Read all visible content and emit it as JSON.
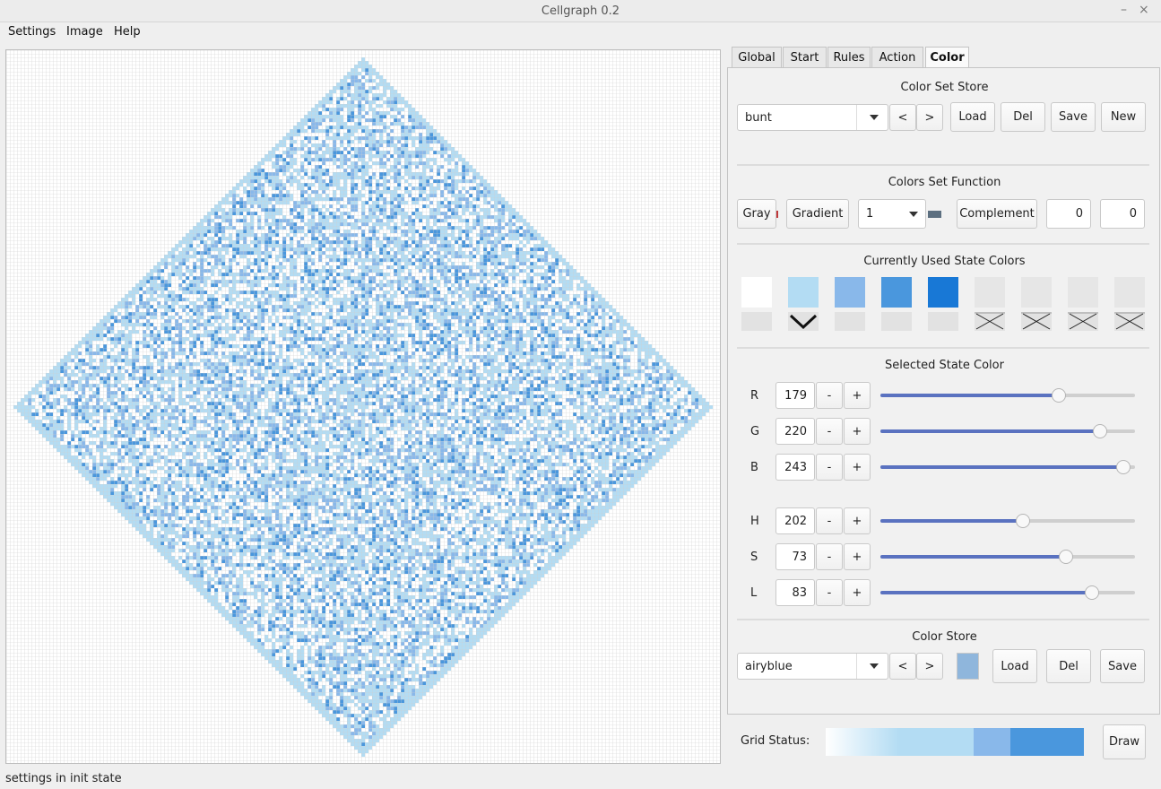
{
  "window": {
    "title": "Cellgraph 0.2",
    "minimize": "–",
    "close": "×"
  },
  "menu": [
    "Settings",
    "Image",
    "Help"
  ],
  "status_text": "settings in init state",
  "tabs": [
    "Global",
    "Start",
    "Rules",
    "Action",
    "Color"
  ],
  "active_tab": "Color",
  "color_set_store": {
    "header": "Color Set Store",
    "selected": "bunt",
    "prev": "<",
    "next": ">",
    "load": "Load",
    "del": "Del",
    "save": "Save",
    "new": "New",
    "swatches": [
      "#a08a4e",
      "#c0393b",
      "#e07b3c",
      "#7ecfcf",
      "#1a9a8e",
      "#f2c94c",
      "#8a1f2e",
      "#5f97ea",
      "#5c6f80"
    ]
  },
  "colors_set_function": {
    "header": "Colors Set Function",
    "gray": "Gray",
    "gradient": "Gradient",
    "steps": "1",
    "complement": "Complement",
    "value_a": "0",
    "value_b": "0"
  },
  "state_colors": {
    "header": "Currently Used State Colors",
    "colors": [
      "#ffffff",
      "#b3dcf3",
      "#89b8ea",
      "#4a97dd",
      "#1878d6",
      "#e6e6e6",
      "#e6e6e6",
      "#e6e6e6",
      "#e6e6e6"
    ],
    "selected_index": 1,
    "disabled_from": 5
  },
  "selected_state_color": {
    "header": "Selected State Color",
    "rgb": [
      {
        "label": "R",
        "value": "179",
        "fraction": 0.702
      },
      {
        "label": "G",
        "value": "220",
        "fraction": 0.863
      },
      {
        "label": "B",
        "value": "243",
        "fraction": 0.953
      }
    ],
    "hsl": [
      {
        "label": "H",
        "value": "202",
        "fraction": 0.561
      },
      {
        "label": "S",
        "value": "73",
        "fraction": 0.73
      },
      {
        "label": "L",
        "value": "83",
        "fraction": 0.83
      }
    ],
    "minus": "-",
    "plus": "+"
  },
  "color_store": {
    "header": "Color Store",
    "selected": "airyblue",
    "prev": "<",
    "next": ">",
    "preview_color": "#8fb6dc",
    "load": "Load",
    "del": "Del",
    "save": "Save"
  },
  "grid_status": {
    "label": "Grid Status:",
    "draw": "Draw",
    "segments": [
      "#ffffff",
      "#b3dcf3",
      "#89b8ea",
      "#4a97dd"
    ]
  },
  "grid_palette": [
    "#ffffff",
    "#b3dcf3",
    "#89b8ea",
    "#4a97dd",
    "#1878d6"
  ]
}
